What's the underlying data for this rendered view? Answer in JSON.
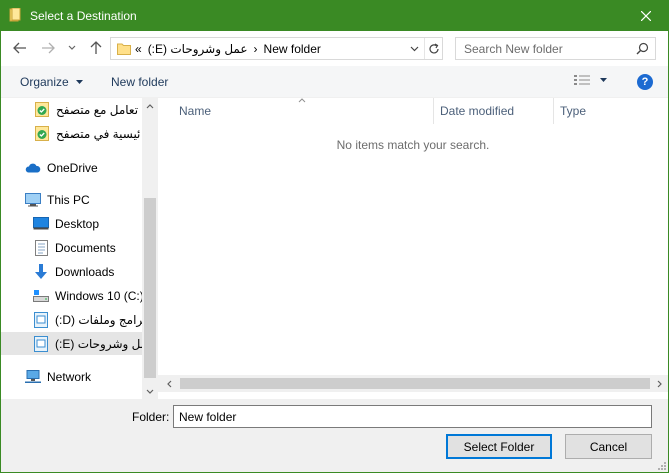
{
  "window": {
    "title": "Select a Destination",
    "close_icon": "close-icon"
  },
  "navigation": {
    "back_icon": "arrow-left-icon",
    "forward_icon": "arrow-right-icon",
    "recent_icon": "chevron-down-icon",
    "up_icon": "arrow-up-icon"
  },
  "address": {
    "overflow": "«",
    "drive": "عمل وشروحات (E:)",
    "separator": "›",
    "folder": "New folder",
    "refresh_icon": "refresh-icon"
  },
  "search": {
    "placeholder": "Search New folder"
  },
  "toolbar": {
    "organize_label": "Organize",
    "new_folder_label": "New folder",
    "help_label": "?"
  },
  "nav_pane": {
    "items": [
      {
        "label": "تعامل مع متصفح",
        "icon": "shortcut-icon",
        "indent": 1
      },
      {
        "label": "ئيسية في متصفح",
        "icon": "shortcut-icon",
        "indent": 1
      },
      {
        "label": "OneDrive",
        "icon": "cloud-icon",
        "indent": 0
      },
      {
        "label": "This PC",
        "icon": "computer-icon",
        "indent": 0
      },
      {
        "label": "Desktop",
        "icon": "desktop-icon",
        "indent": 1
      },
      {
        "label": "Documents",
        "icon": "documents-icon",
        "indent": 1
      },
      {
        "label": "Downloads",
        "icon": "download-icon",
        "indent": 1
      },
      {
        "label": "Windows 10 (C:)",
        "icon": "drive-icon",
        "indent": 1
      },
      {
        "label": "برامج وملفات (D:)",
        "icon": "drive-icon",
        "indent": 1
      },
      {
        "label": "عمل وشروحات (E:)",
        "icon": "drive-icon",
        "indent": 1,
        "selected": true
      },
      {
        "label": "Network",
        "icon": "network-icon",
        "indent": 0
      }
    ]
  },
  "file_list": {
    "columns": [
      "Name",
      "Date modified",
      "Type"
    ],
    "empty_message": "No items match your search."
  },
  "footer": {
    "folder_label": "Folder:",
    "folder_value": "New folder",
    "select_button": "Select Folder",
    "cancel_button": "Cancel"
  },
  "colors": {
    "titlebar": "#3a8a24",
    "accent": "#0078d7",
    "help": "#1c6ad1"
  }
}
